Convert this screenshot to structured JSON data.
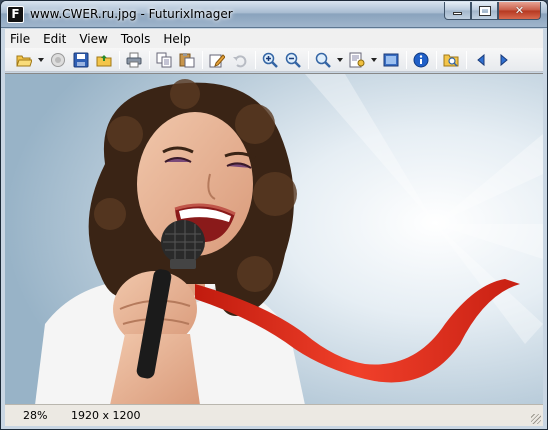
{
  "window": {
    "title": "www.CWER.ru.jpg - FuturixImager",
    "app_logo_letter": "F"
  },
  "menu": [
    "File",
    "Edit",
    "View",
    "Tools",
    "Help"
  ],
  "toolbar": {
    "buttons": [
      "open-folder-icon",
      "dropdown",
      "stop-icon",
      "save-icon",
      "folder-up-icon",
      "print-icon",
      "copy-icon",
      "paste-icon",
      "edit-icon",
      "undo-icon",
      "zoom-in-icon",
      "zoom-out-icon",
      "zoom-icon",
      "dropdown",
      "page-setup-icon",
      "dropdown",
      "fullscreen-icon",
      "info-icon",
      "browse-icon",
      "previous-icon",
      "next-icon"
    ]
  },
  "status": {
    "zoom": "28%",
    "dimensions": "1920 x 1200"
  },
  "colors": {
    "ribbon": "#e0301e",
    "hair": "#3a2415",
    "sky": "#c9d9e5",
    "shirt": "#f4f4f4"
  }
}
